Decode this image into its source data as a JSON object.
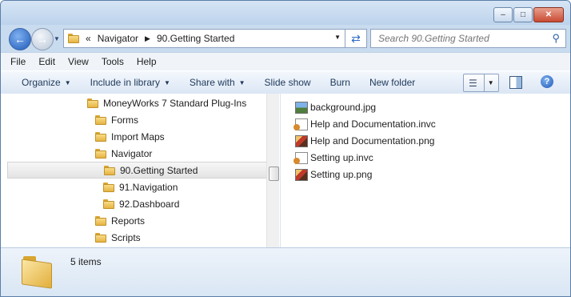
{
  "window": {
    "minimize_glyph": "–",
    "maximize_glyph": "□",
    "close_glyph": "✕"
  },
  "navigation": {
    "back_glyph": "←",
    "forward_glyph": "→",
    "history_glyph": "▼"
  },
  "address": {
    "overflow": "«",
    "crumbs": [
      "Navigator",
      "90.Getting Started"
    ],
    "separator": "▶",
    "dropdown_glyph": "▼",
    "refresh_glyph": "⇄"
  },
  "search": {
    "placeholder": "Search 90.Getting Started",
    "icon_glyph": "⚲"
  },
  "menu": [
    "File",
    "Edit",
    "View",
    "Tools",
    "Help"
  ],
  "toolbar": {
    "organize": "Organize",
    "include_in_library": "Include in library",
    "share_with": "Share with",
    "slide_show": "Slide show",
    "burn": "Burn",
    "new_folder": "New folder",
    "dropdown_glyph": "▼",
    "views_glyph": "☰",
    "help_glyph": "?"
  },
  "tree": {
    "items": [
      {
        "label": "MoneyWorks 7 Standard Plug-Ins",
        "level": 0
      },
      {
        "label": "Forms",
        "level": 1
      },
      {
        "label": "Import Maps",
        "level": 1
      },
      {
        "label": "Navigator",
        "level": 1
      },
      {
        "label": "90.Getting Started",
        "level": 2,
        "selected": true
      },
      {
        "label": "91.Navigation",
        "level": 2
      },
      {
        "label": "92.Dashboard",
        "level": 2
      },
      {
        "label": "Reports",
        "level": 1
      },
      {
        "label": "Scripts",
        "level": 1
      }
    ]
  },
  "files": [
    {
      "name": "background.jpg",
      "icon": "jpg-image-icon"
    },
    {
      "name": "Help and Documentation.invc",
      "icon": "invc-document-icon"
    },
    {
      "name": "Help and Documentation.png",
      "icon": "png-image-icon"
    },
    {
      "name": "Setting up.invc",
      "icon": "invc-document-icon"
    },
    {
      "name": "Setting up.png",
      "icon": "png-image-icon"
    }
  ],
  "details": {
    "item_count": "5 items"
  },
  "colors": {
    "chrome": "#c9dbee",
    "selection": "#e4e4e4",
    "accent": "#1f59b8"
  }
}
